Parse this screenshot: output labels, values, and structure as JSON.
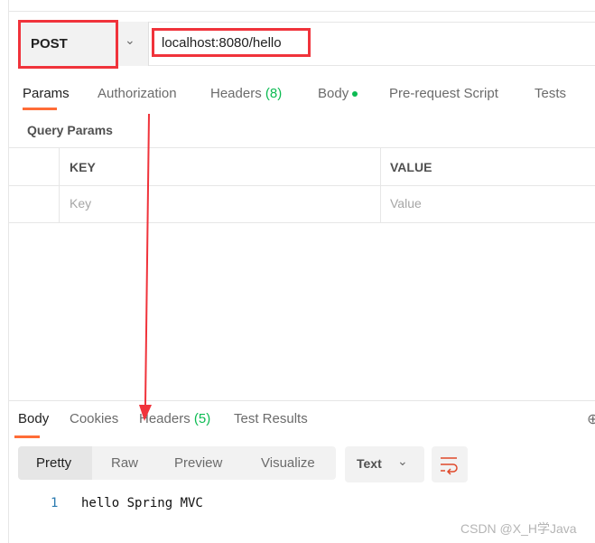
{
  "request": {
    "method": "POST",
    "url": "localhost:8080/hello",
    "tabs": [
      {
        "label": "Params"
      },
      {
        "label": "Authorization"
      },
      {
        "label": "Headers",
        "count": "(8)"
      },
      {
        "label": "Body"
      },
      {
        "label": "Pre-request Script"
      },
      {
        "label": "Tests"
      }
    ],
    "query_params_title": "Query Params",
    "table": {
      "headers": [
        "KEY",
        "VALUE"
      ],
      "placeholders": {
        "key": "Key",
        "value": "Value"
      }
    }
  },
  "response": {
    "tabs": [
      {
        "label": "Body"
      },
      {
        "label": "Cookies"
      },
      {
        "label": "Headers",
        "count": "(5)"
      },
      {
        "label": "Test Results"
      }
    ],
    "view_modes": [
      "Pretty",
      "Raw",
      "Preview",
      "Visualize"
    ],
    "format": "Text",
    "lines": [
      {
        "number": "1",
        "text": "hello Spring MVC"
      }
    ]
  },
  "watermark": "CSDN @X_H学Java",
  "colors": {
    "accent": "#ff6c37",
    "annotation": "#f0333b",
    "count": "#0cbb52"
  }
}
